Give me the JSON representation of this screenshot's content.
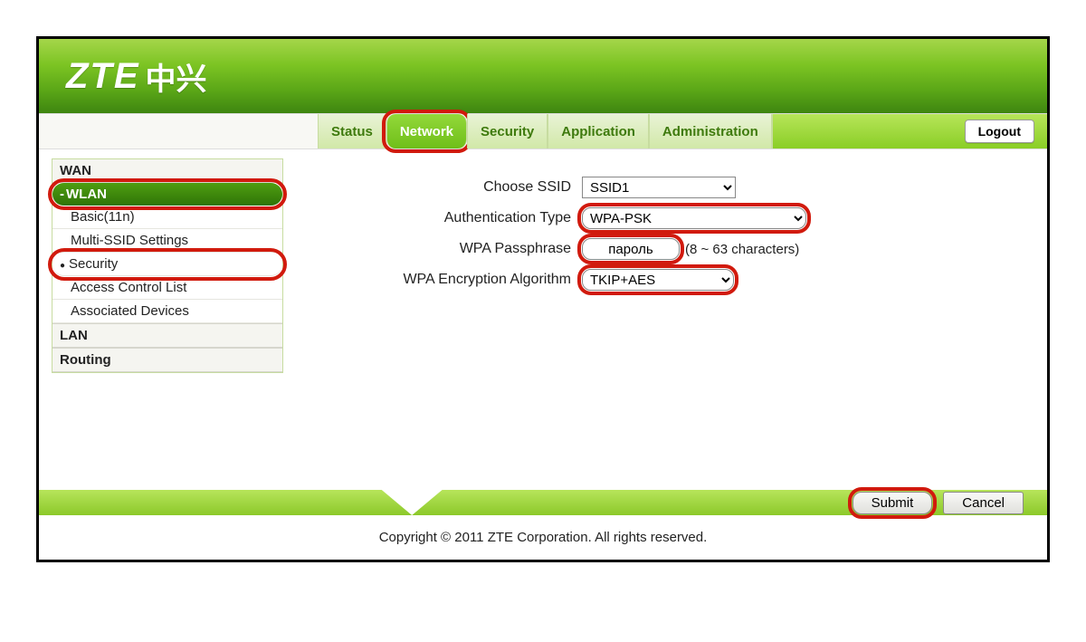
{
  "logo": {
    "brand": "ZTE",
    "cn": "中兴"
  },
  "tabs": {
    "status": "Status",
    "network": "Network",
    "security": "Security",
    "application": "Application",
    "administration": "Administration"
  },
  "logout_label": "Logout",
  "sidebar": {
    "wan": "WAN",
    "wlan": "WLAN",
    "subs": {
      "basic": "Basic(11n)",
      "multi_ssid": "Multi-SSID Settings",
      "security": "Security",
      "acl": "Access Control List",
      "assoc": "Associated Devices"
    },
    "lan": "LAN",
    "routing": "Routing"
  },
  "form": {
    "labels": {
      "ssid": "Choose SSID",
      "auth": "Authentication Type",
      "pass": "WPA Passphrase",
      "enc": "WPA Encryption Algorithm"
    },
    "values": {
      "ssid": "SSID1",
      "auth": "WPA-PSK",
      "pass": "пароль",
      "enc": "TKIP+AES"
    },
    "pass_hint": "(8 ~ 63 characters)"
  },
  "footer": {
    "submit": "Submit",
    "cancel": "Cancel",
    "copyright": "Copyright © 2011 ZTE Corporation. All rights reserved."
  }
}
